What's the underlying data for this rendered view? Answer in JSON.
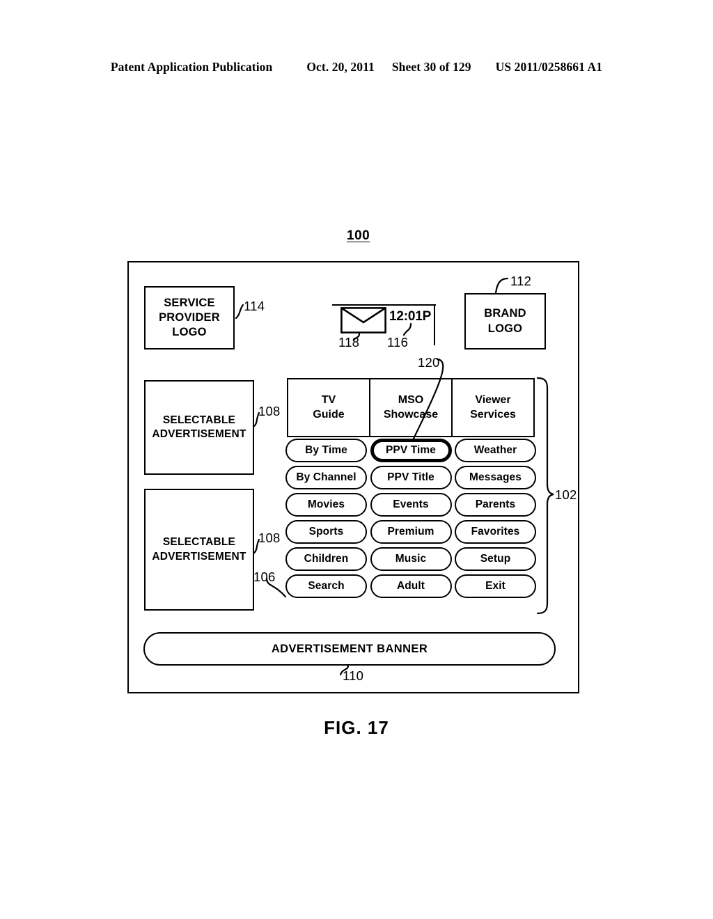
{
  "header": {
    "publication": "Patent Application Publication",
    "date": "Oct. 20, 2011",
    "sheet": "Sheet 30 of 129",
    "number": "US 2011/0258661 A1"
  },
  "figure": {
    "caption": "FIG. 17",
    "system_ref": "100"
  },
  "screen": {
    "service_provider_logo": "SERVICE\nPROVIDER\nLOGO",
    "service_provider_logo_lines": [
      "SERVICE",
      "PROVIDER",
      "LOGO"
    ],
    "brand_logo_lines": [
      "BRAND",
      "LOGO"
    ],
    "clock_time": "12:01P",
    "mail_icon": "envelope-icon",
    "advertisement_1_lines": [
      "SELECTABLE",
      "ADVERTISEMENT"
    ],
    "advertisement_2_lines": [
      "SELECTABLE",
      "ADVERTISEMENT"
    ],
    "banner_label": "ADVERTISEMENT BANNER"
  },
  "menu": {
    "headers": [
      {
        "lines": [
          "TV",
          "Guide"
        ]
      },
      {
        "lines": [
          "MSO",
          "Showcase"
        ]
      },
      {
        "lines": [
          "Viewer",
          "Services"
        ]
      }
    ],
    "rows": [
      [
        {
          "label": "By Time",
          "highlighted": false
        },
        {
          "label": "PPV Time",
          "highlighted": true
        },
        {
          "label": "Weather",
          "highlighted": false
        }
      ],
      [
        {
          "label": "By Channel",
          "highlighted": false
        },
        {
          "label": "PPV Title",
          "highlighted": false
        },
        {
          "label": "Messages",
          "highlighted": false
        }
      ],
      [
        {
          "label": "Movies",
          "highlighted": false
        },
        {
          "label": "Events",
          "highlighted": false
        },
        {
          "label": "Parents",
          "highlighted": false
        }
      ],
      [
        {
          "label": "Sports",
          "highlighted": false
        },
        {
          "label": "Premium",
          "highlighted": false
        },
        {
          "label": "Favorites",
          "highlighted": false
        }
      ],
      [
        {
          "label": "Children",
          "highlighted": false
        },
        {
          "label": "Music",
          "highlighted": false
        },
        {
          "label": "Setup",
          "highlighted": false
        }
      ],
      [
        {
          "label": "Search",
          "highlighted": false
        },
        {
          "label": "Adult",
          "highlighted": false
        },
        {
          "label": "Exit",
          "highlighted": false
        }
      ]
    ]
  },
  "reference_numerals": {
    "screen": "100",
    "menu_region": "102",
    "menu_buttons": "106",
    "selectable_ad_1": "108",
    "selectable_ad_2": "108",
    "ad_banner": "110",
    "brand_logo": "112",
    "service_provider_logo": "114",
    "clock": "116",
    "mail_indicator": "118",
    "highlighted_button": "120"
  }
}
